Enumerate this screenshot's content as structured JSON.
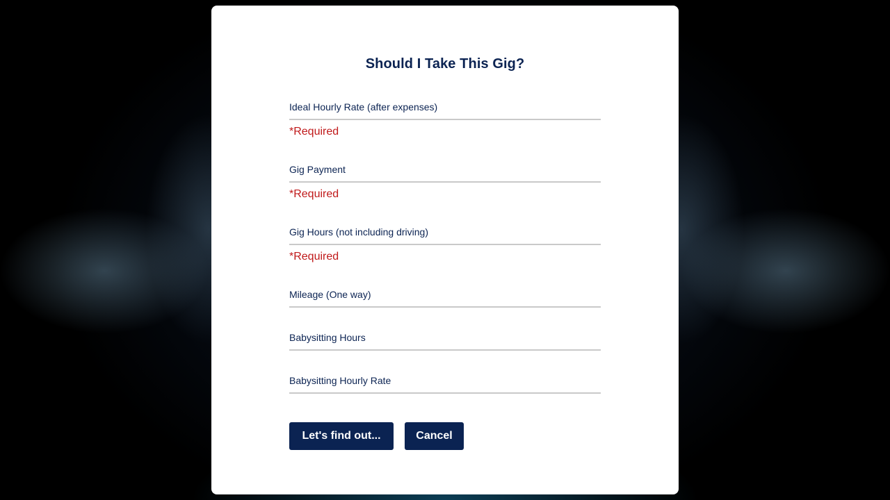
{
  "modal": {
    "title": "Should I Take This Gig?"
  },
  "form": {
    "fields": [
      {
        "label": "Ideal Hourly Rate (after expenses)",
        "value": "",
        "error": "*Required"
      },
      {
        "label": "Gig Payment",
        "value": "",
        "error": "*Required"
      },
      {
        "label": "Gig Hours (not including driving)",
        "value": "",
        "error": "*Required"
      },
      {
        "label": "Mileage (One way)",
        "value": "",
        "error": ""
      },
      {
        "label": "Babysitting Hours",
        "value": "",
        "error": ""
      },
      {
        "label": "Babysitting Hourly Rate",
        "value": "",
        "error": ""
      }
    ],
    "submit_label": "Let's find out...",
    "cancel_label": "Cancel"
  },
  "colors": {
    "primary": "#0b2352",
    "error": "#c0191a",
    "underline": "#c9c9c9"
  }
}
